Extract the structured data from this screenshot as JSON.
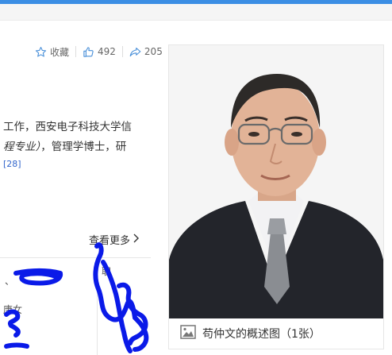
{
  "actions": {
    "favorite_label": "收藏",
    "like_count": "492",
    "share_count": "205"
  },
  "summary": {
    "line1": "工作，西安电子科技大学信",
    "line2_italic": "程专业）",
    "line2_rest": "，管理学博士，研",
    "citation": "[28]"
  },
  "more_label": "查看更多",
  "lower_fragments": [
    "、",
    "职",
    "唐女"
  ],
  "album": {
    "caption": "苟仲文的概述图（1张）"
  },
  "colors": {
    "accent_bar": "#3b8ee4",
    "link": "#3366cc",
    "scribble": "#0a1ae8"
  }
}
